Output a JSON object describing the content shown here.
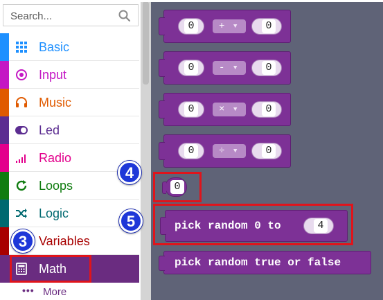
{
  "search": {
    "placeholder": "Search..."
  },
  "categories": [
    {
      "label": "Basic",
      "icon": "grid-icon",
      "color": "#1e90ff"
    },
    {
      "label": "Input",
      "icon": "input-circle-icon",
      "color": "#c417c4"
    },
    {
      "label": "Music",
      "icon": "headphones-icon",
      "color": "#e05a00"
    },
    {
      "label": "Led",
      "icon": "toggle-icon",
      "color": "#5c2d91"
    },
    {
      "label": "Radio",
      "icon": "signal-bars-icon",
      "color": "#e3008c"
    },
    {
      "label": "Loops",
      "icon": "refresh-icon",
      "color": "#107c10"
    },
    {
      "label": "Logic",
      "icon": "shuffle-icon",
      "color": "#006970"
    },
    {
      "label": "Variables",
      "icon": "variable-icon",
      "color": "#a80000"
    },
    {
      "label": "Math",
      "icon": "calculator-icon",
      "color": "#6a2c80"
    }
  ],
  "more_label": "More",
  "blocks": {
    "add": {
      "left": "0",
      "op": "+",
      "right": "0"
    },
    "subtract": {
      "left": "0",
      "op": "-",
      "right": "0"
    },
    "multiply": {
      "left": "0",
      "op": "×",
      "right": "0"
    },
    "divide": {
      "left": "0",
      "op": "÷",
      "right": "0"
    },
    "number": {
      "value": "0"
    },
    "random": {
      "text": "pick random 0 to",
      "max": "4"
    },
    "random_bool": {
      "text": "pick random true or false"
    }
  },
  "badges": {
    "b3": "3",
    "b4": "4",
    "b5": "5"
  },
  "colors": {
    "math": "#7d3196",
    "workspace": "#5f6377",
    "highlight": "#e0141b",
    "badge": "#1e37d8"
  }
}
